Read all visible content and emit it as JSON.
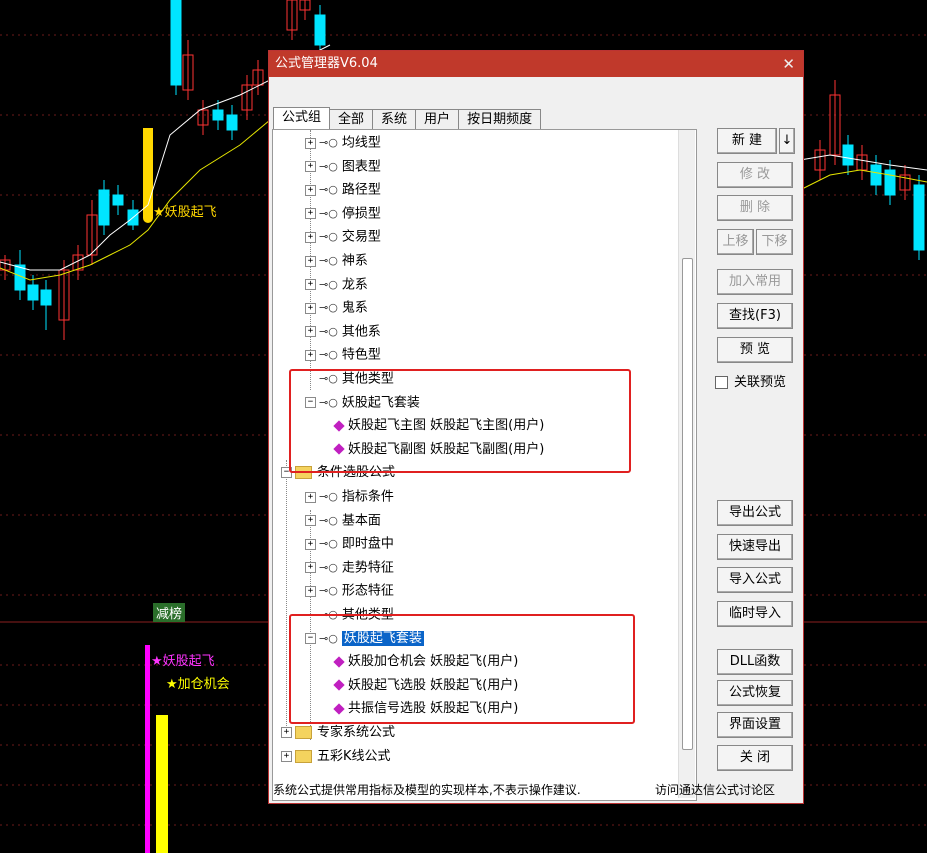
{
  "chart_labels": {
    "top_signal": "★妖股起飞",
    "tab_label": "减榜",
    "bottom_signal1": "★妖股起飞",
    "bottom_signal2": "★加仓机会"
  },
  "window": {
    "title": "公式管理器V6.04",
    "close": "✕"
  },
  "tabs": [
    "公式组",
    "全部",
    "系统",
    "用户",
    "按日期频度"
  ],
  "tree": [
    {
      "label": "均线型",
      "type": "closed"
    },
    {
      "label": "图表型",
      "type": "closed"
    },
    {
      "label": "路径型",
      "type": "closed"
    },
    {
      "label": "停损型",
      "type": "closed"
    },
    {
      "label": "交易型",
      "type": "closed"
    },
    {
      "label": "神系",
      "type": "closed"
    },
    {
      "label": "龙系",
      "type": "closed"
    },
    {
      "label": "鬼系",
      "type": "closed"
    },
    {
      "label": "其他系",
      "type": "closed"
    },
    {
      "label": "特色型",
      "type": "closed"
    },
    {
      "label": "其他类型",
      "type": "leaf"
    },
    {
      "label": "妖股起飞套装",
      "type": "open"
    },
    {
      "label": "妖股起飞主图  妖股起飞主图(用户)",
      "type": "formula"
    },
    {
      "label": "妖股起飞副图  妖股起飞副图(用户)",
      "type": "formula"
    },
    {
      "label": "条件选股公式",
      "type": "folder_open"
    },
    {
      "label": "指标条件",
      "type": "closed"
    },
    {
      "label": "基本面",
      "type": "closed"
    },
    {
      "label": "即时盘中",
      "type": "closed"
    },
    {
      "label": "走势特征",
      "type": "closed"
    },
    {
      "label": "形态特征",
      "type": "closed"
    },
    {
      "label": "其他类型",
      "type": "leaf"
    },
    {
      "label": "妖股起飞套装",
      "type": "open_sel"
    },
    {
      "label": "妖股加仓机会  妖股起飞(用户)",
      "type": "formula"
    },
    {
      "label": "妖股起飞选股  妖股起飞(用户)",
      "type": "formula"
    },
    {
      "label": "共振信号选股  妖股起飞(用户)",
      "type": "formula"
    },
    {
      "label": "专家系统公式",
      "type": "folder_closed"
    },
    {
      "label": "五彩K线公式",
      "type": "folder_closed"
    }
  ],
  "buttons": {
    "new": "新 建",
    "new_arrow": "↓",
    "modify": "修 改",
    "delete": "删 除",
    "up": "上移",
    "down": "下移",
    "add_common": "加入常用",
    "find": "查找(F3)",
    "preview": "预 览",
    "link_preview": "关联预览",
    "export": "导出公式",
    "quick_export": "快速导出",
    "import": "导入公式",
    "temp_import": "临时导入",
    "dll": "DLL函数",
    "restore": "公式恢复",
    "ui_settings": "界面设置",
    "close": "关 闭"
  },
  "status": {
    "left": "系统公式提供常用指标及模型的实现样本,不表示操作建议.",
    "right": "访问通达信公式讨论区"
  },
  "colors": {
    "up": "#ff3333",
    "down": "#00e5ff",
    "ma1": "#ffffff",
    "ma2": "#e6e600",
    "signal_magenta": "#ff00ff",
    "signal_yellow": "#ffff00",
    "highlight": "#e02020"
  }
}
